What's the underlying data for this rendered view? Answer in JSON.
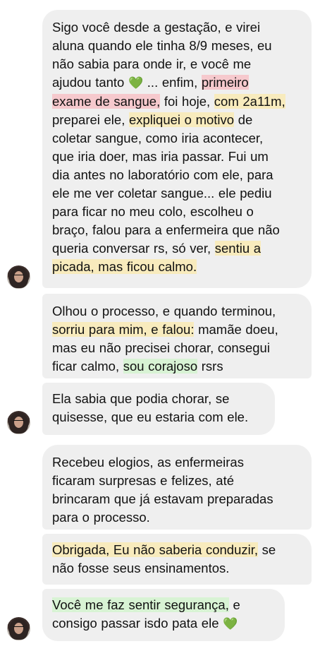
{
  "messages": [
    {
      "lines": [
        [
          {
            "t": "Sigo você desde a gestação, e virei"
          }
        ],
        [
          {
            "t": "aluna quando ele tinha 8/9 meses, eu"
          }
        ],
        [
          {
            "t": "não sabia para onde ir, e você me"
          }
        ],
        [
          {
            "t": "ajudou tanto "
          },
          {
            "t": "💚",
            "icon": "green-heart-emoji"
          },
          {
            "t": " ... enfim, "
          },
          {
            "t": "primeiro",
            "h": "red"
          }
        ],
        [
          {
            "t": "exame de sangue,",
            "h": "red"
          },
          {
            "t": " foi hoje, "
          },
          {
            "t": "com 2a11m,",
            "h": "yellow"
          }
        ],
        [
          {
            "t": "preparei ele, "
          },
          {
            "t": "expliquei o motivo",
            "h": "yellow"
          },
          {
            "t": " de"
          }
        ],
        [
          {
            "t": "coletar sangue, como iria acontecer,"
          }
        ],
        [
          {
            "t": "que iria doer, mas iria passar. Fui um"
          }
        ],
        [
          {
            "t": "dia antes no laboratório com ele, para"
          }
        ],
        [
          {
            "t": "ele me ver coletar sangue... ele pediu"
          }
        ],
        [
          {
            "t": "para ficar no meu colo, escolheu o"
          }
        ],
        [
          {
            "t": "braço, falou para a enfermeira que não"
          }
        ],
        [
          {
            "t": "queria conversar rs, só ver, "
          },
          {
            "t": "sentiu a",
            "h": "yellow"
          }
        ],
        [
          {
            "t": "picada, mas ficou calmo.",
            "h": "yellow"
          }
        ]
      ]
    },
    {
      "lines": [
        [
          {
            "t": "Olhou o processo, e quando terminou,"
          }
        ],
        [
          {
            "t": "sorriu para mim, e falou:",
            "h": "yellow"
          },
          {
            "t": " mamãe doeu,"
          }
        ],
        [
          {
            "t": "mas eu não precisei chorar, consegui"
          }
        ],
        [
          {
            "t": "ficar calmo, "
          },
          {
            "t": "sou corajoso",
            "h": "green"
          },
          {
            "t": " rsrs"
          }
        ]
      ]
    },
    {
      "lines": [
        [
          {
            "t": "Ela sabia que podia chorar, se"
          }
        ],
        [
          {
            "t": "quisesse, que eu estaria com ele."
          }
        ]
      ]
    },
    {
      "lines": [
        [
          {
            "t": "Recebeu elogios, as enfermeiras"
          }
        ],
        [
          {
            "t": "ficaram surpresas e felizes, até"
          }
        ],
        [
          {
            "t": "brincaram que já estavam preparadas"
          }
        ],
        [
          {
            "t": "para o processo."
          }
        ]
      ]
    },
    {
      "lines": [
        [
          {
            "t": "Obrigada, Eu não saberia conduzir,",
            "h": "yellow"
          },
          {
            "t": " se"
          }
        ],
        [
          {
            "t": "não fosse seus ensinamentos."
          }
        ]
      ]
    },
    {
      "lines": [
        [
          {
            "t": "Você me faz sentir segurança,",
            "h": "green"
          },
          {
            "t": " e"
          }
        ],
        [
          {
            "t": "consigo passar isdo pata ele "
          },
          {
            "t": "💚",
            "icon": "green-heart-emoji"
          }
        ]
      ]
    }
  ],
  "colors": {
    "bubble_background": "#efefef",
    "highlight_red": "#f6c9cd",
    "highlight_yellow": "#f8ebbd",
    "highlight_green": "#d8f3d4",
    "heart": "#2fa84f"
  }
}
